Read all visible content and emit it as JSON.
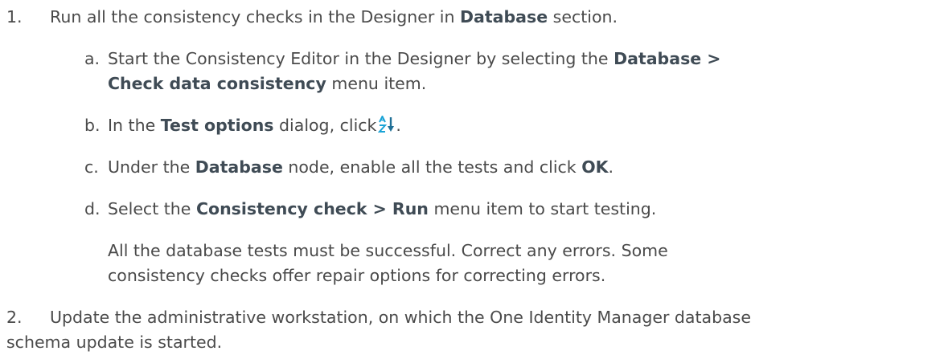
{
  "steps": [
    {
      "number": "1.",
      "text_before": "Run all the consistency checks in the Designer in",
      "bold": "Database",
      "text_after": "section.",
      "substeps": [
        {
          "letter": "a.",
          "line1_before": "Start the Consistency Editor in the Designer by selecting the",
          "line1_bold": "Database >",
          "line2_bold": "Check data consistency",
          "line2_after": "menu item."
        },
        {
          "letter": "b.",
          "text_before": "In the",
          "bold": "Test options",
          "text_mid": "dialog, click",
          "icon": "sort-az-icon",
          "text_after": "."
        },
        {
          "letter": "c.",
          "text_before": "Under the",
          "bold": "Database",
          "text_mid": "node, enable all the tests and click",
          "bold2": "OK",
          "text_after": "."
        },
        {
          "letter": "d.",
          "text_before": "Select the",
          "bold": "Consistency check > Run",
          "text_after": "menu item to start testing."
        }
      ],
      "note_line1": "All the database tests must be successful. Correct any errors. Some",
      "note_line2": "consistency checks offer repair options for correcting errors."
    },
    {
      "number": "2.",
      "line1": "Update the administrative workstation, on which the One Identity Manager database",
      "line2": "schema update is started."
    }
  ],
  "colors": {
    "text": "#4a4a4a",
    "bold": "#3f4b55",
    "icon_blue": "#1aa3d6",
    "icon_dark": "#1f6f96"
  }
}
